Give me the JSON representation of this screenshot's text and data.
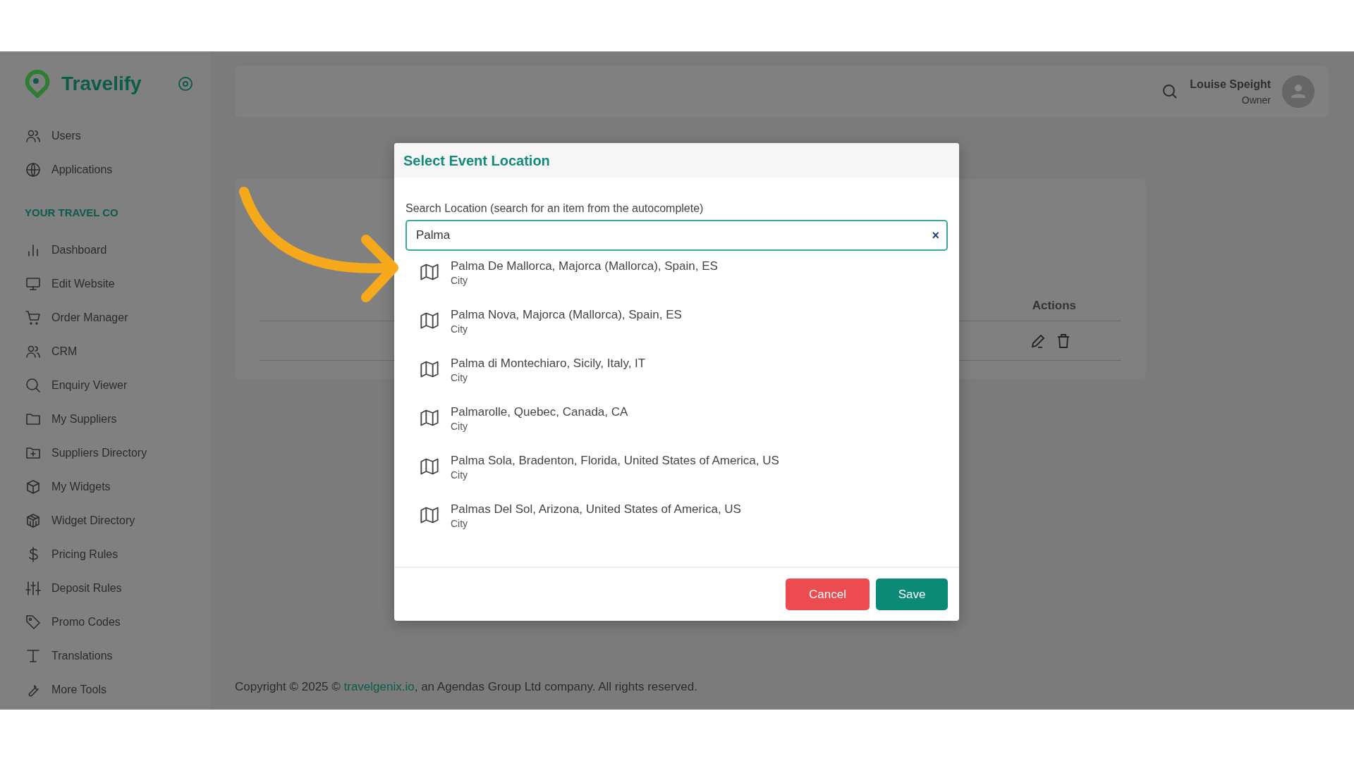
{
  "sidebar": {
    "brand": "Travelify",
    "items": [
      {
        "kind": "link",
        "label": "Users"
      },
      {
        "kind": "link",
        "label": "Applications"
      },
      {
        "kind": "heading",
        "label": "YOUR TRAVEL CO"
      },
      {
        "kind": "link",
        "label": "Dashboard"
      },
      {
        "kind": "link",
        "label": "Edit Website"
      },
      {
        "kind": "link",
        "label": "Order Manager"
      },
      {
        "kind": "link",
        "label": "CRM"
      },
      {
        "kind": "link",
        "label": "Enquiry Viewer"
      },
      {
        "kind": "link",
        "label": "My Suppliers"
      },
      {
        "kind": "link",
        "label": "Suppliers Directory"
      },
      {
        "kind": "link",
        "label": "My Widgets"
      },
      {
        "kind": "link",
        "label": "Widget Directory"
      },
      {
        "kind": "link",
        "label": "Pricing Rules"
      },
      {
        "kind": "link",
        "label": "Deposit Rules"
      },
      {
        "kind": "link",
        "label": "Promo Codes"
      },
      {
        "kind": "link",
        "label": "Translations"
      },
      {
        "kind": "link",
        "label": "More Tools"
      }
    ]
  },
  "header": {
    "user_name": "Louise Speight",
    "user_role": "Owner"
  },
  "table": {
    "columns": [
      "Actions"
    ]
  },
  "footer": {
    "before": "Copyright © 2025 © ",
    "link": "travelgenix.io",
    "after": ", an Agendas Group Ltd company. All rights reserved."
  },
  "modal": {
    "title": "Select Event Location",
    "field_label": "Search Location (search for an item from the autocomplete)",
    "value": "Palma",
    "clear": "×",
    "results": [
      {
        "name": "Palma De Mallorca, Majorca (Mallorca), Spain, ES",
        "type": "City"
      },
      {
        "name": "Palma Nova, Majorca (Mallorca), Spain, ES",
        "type": "City"
      },
      {
        "name": "Palma di Montechiaro, Sicily, Italy, IT",
        "type": "City"
      },
      {
        "name": "Palmarolle, Quebec, Canada, CA",
        "type": "City"
      },
      {
        "name": "Palma Sola, Bradenton, Florida, United States of America, US",
        "type": "City"
      },
      {
        "name": "Palmas Del Sol, Arizona, United States of America, US",
        "type": "City"
      }
    ],
    "buttons": [
      {
        "label": "Cancel",
        "kind": "danger"
      },
      {
        "label": "Save",
        "kind": "primary"
      }
    ]
  }
}
